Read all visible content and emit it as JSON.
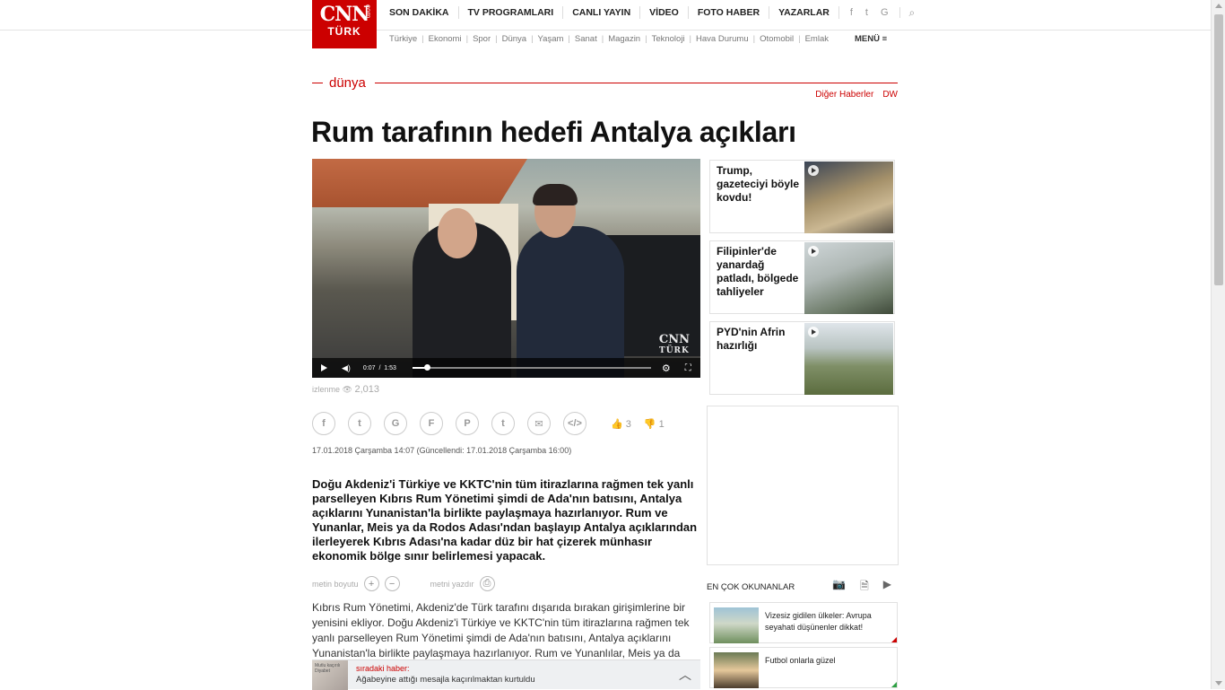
{
  "logo": {
    "line1": "CNN",
    "line2": "TÜRK",
    "line3": "com"
  },
  "nav": {
    "items": [
      "SON DAKİKA",
      "TV PROGRAMLARI",
      "CANLI YAYIN",
      "VİDEO",
      "FOTO HABER",
      "YAZARLAR"
    ],
    "social": [
      "f",
      "t",
      "G"
    ],
    "search_icon": "⌕"
  },
  "subnav": {
    "items": [
      "Türkiye",
      "Ekonomi",
      "Spor",
      "Dünya",
      "Yaşam",
      "Sanat",
      "Magazin",
      "Teknoloji",
      "Hava Durumu",
      "Otomobil",
      "Emlak"
    ],
    "menu_label": "MENÜ ≡"
  },
  "section": {
    "name": "dünya",
    "related1": "Diğer Haberler",
    "related2": "DW"
  },
  "article": {
    "title": "Rum tarafının hedefi Antalya açıkları",
    "views_label": "izlenme",
    "views_count": "2,013",
    "likes": "3",
    "dislikes": "1",
    "date": "17.01.2018 Çarşamba 14:07 (Güncellendi: 17.01.2018 Çarşamba 16:00)",
    "lead": "Doğu Akdeniz'i Türkiye ve KKTC'nin tüm itirazlarına rağmen tek yanlı parselleyen Kıbrıs Rum Yönetimi şimdi de Ada'nın batısını, Antalya açıklarını Yunanistan'la birlikte paylaşmaya hazırlanıyor. Rum ve Yunanlar, Meis ya da Rodos Adası'ndan başlayıp Antalya açıklarından ilerleyerek Kıbrıs Adası'na kadar düz bir hat çizerek münhasır ekonomik bölge sınır belirlemesi yapacak.",
    "text_size_label": "metin boyutu",
    "print_label": "metni yazdır",
    "body": "Kıbrıs Rum Yönetimi, Akdeniz'de Türk tarafını dışarıda bırakan girişimlerine bir yenisini ekliyor. Doğu Akdeniz'i Türkiye ve KKTC'nin tüm itirazlarına rağmen tek yanlı parselleyen Rum Yönetimi şimdi de Ada'nın batısını, Antalya açıklarını Yunanistan'la birlikte paylaşmaya hazırlanıyor. Rum ve Yunanlılar, Meis ya da"
  },
  "video": {
    "current_time": "0:07",
    "separator": "/",
    "duration": "1:53",
    "progress": 0.062,
    "watermark": "CNN",
    "watermark_sub": "TÜRK"
  },
  "share_icons": [
    "f",
    "t",
    "G",
    "F",
    "P",
    "t",
    "✉",
    "</>"
  ],
  "side_videos": [
    {
      "title": "Trump, gazeteciyi böyle kovdu!"
    },
    {
      "title": "Filipinler'de yanardağ patladı, bölgede tahliyeler"
    },
    {
      "title": "PYD'nin Afrin hazırlığı"
    }
  ],
  "most_read": {
    "title": "EN ÇOK OKUNANLAR",
    "items": [
      {
        "text": "Vizesiz gidilen ülkeler: Avrupa seyahati düşünenler dikkat!"
      },
      {
        "text": "Futbol onlarla güzel"
      }
    ]
  },
  "next_bar": {
    "label": "sıradaki haber:",
    "title": "Ağabeyine attığı mesajla kaçırılmaktan kurtuldu",
    "thumb_text": "Mutlu kaçırılı Diyabet"
  },
  "colors": {
    "brand": "#cc0000"
  }
}
